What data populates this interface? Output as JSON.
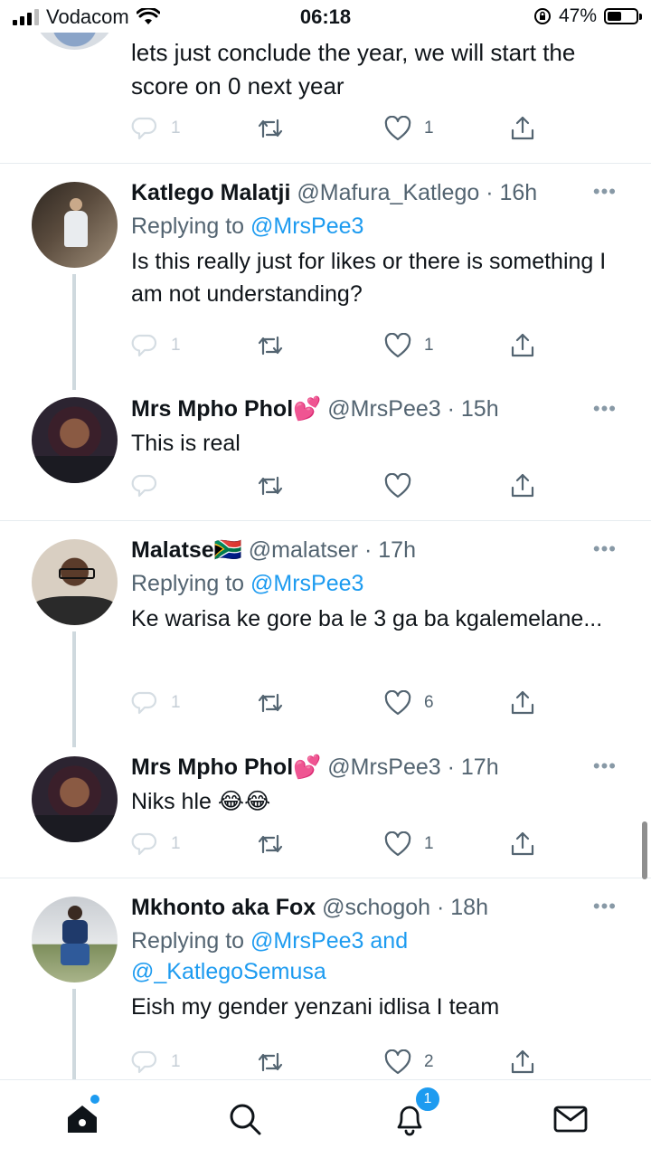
{
  "status_bar": {
    "carrier": "Vodacom",
    "time": "06:18",
    "battery": "47%"
  },
  "tweets": [
    {
      "text": "lets just conclude the year, we will start the score on 0 next year",
      "reply_count": "1",
      "like_count": "1"
    },
    {
      "name": "Katlego Malatji",
      "handle": "@Mafura_Katlego",
      "time": "· 16h",
      "replying_label": "Replying to",
      "replying_to": "@MrsPee3",
      "text": "Is this really just for likes or there is something I am not understanding?",
      "reply_count": "1",
      "like_count": "1"
    },
    {
      "name": "Mrs Mpho Phol💕",
      "handle": "@MrsPee3",
      "time": "· 15h",
      "text": "This is real",
      "reply_count": "",
      "like_count": ""
    },
    {
      "name": "Malatse🇿🇦",
      "handle": "@malatser",
      "time": "· 17h",
      "replying_label": "Replying to",
      "replying_to": "@MrsPee3",
      "text": "Ke warisa ke gore ba le 3 ga ba kgalemelane...",
      "reply_count": "1",
      "like_count": "6"
    },
    {
      "name": "Mrs Mpho Phol💕",
      "handle": "@MrsPee3",
      "time": "· 17h",
      "text": "Niks hle 😂😂",
      "reply_count": "1",
      "like_count": "1"
    },
    {
      "name": "Mkhonto aka Fox",
      "handle": "@schogoh",
      "time": "· 18h",
      "replying_label": "Replying to",
      "replying_to": "@MrsPee3 and @_KatlegoSemusa",
      "text": "Eish my gender yenzani idlisa I team",
      "reply_count": "1",
      "like_count": "2"
    }
  ],
  "tab_bar": {
    "notifications_badge": "1",
    "icons": [
      "home-icon",
      "search-icon",
      "notifications-icon",
      "messages-icon"
    ]
  },
  "colors": {
    "accent": "#1d9bf0",
    "text": "#0f1419",
    "muted": "#536471",
    "divider": "#e6ecf0"
  }
}
